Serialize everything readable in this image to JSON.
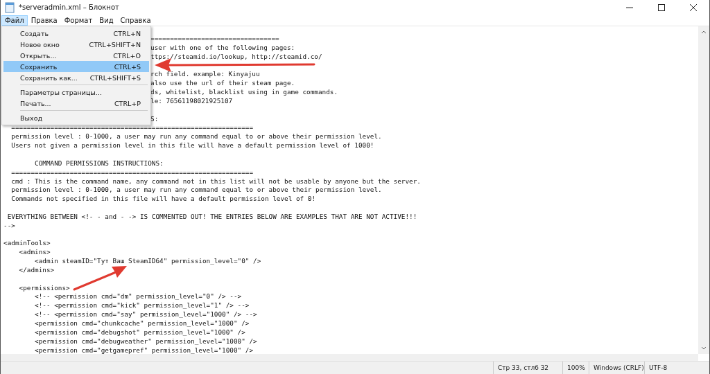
{
  "window": {
    "title": "*serveradmin.xml – Блокнот"
  },
  "menubar": [
    {
      "label": "Файл",
      "selected": true
    },
    {
      "label": "Правка",
      "selected": false
    },
    {
      "label": "Формат",
      "selected": false
    },
    {
      "label": "Вид",
      "selected": false
    },
    {
      "label": "Справка",
      "selected": false
    }
  ],
  "file_menu": [
    {
      "kind": "item",
      "label": "Создать",
      "shortcut": "CTRL+N",
      "selected": false
    },
    {
      "kind": "item",
      "label": "Новое окно",
      "shortcut": "CTRL+SHIFT+N",
      "selected": false
    },
    {
      "kind": "item",
      "label": "Открыть...",
      "shortcut": "CTRL+O",
      "selected": false
    },
    {
      "kind": "item",
      "label": "Сохранить",
      "shortcut": "CTRL+S",
      "selected": true
    },
    {
      "kind": "item",
      "label": "Сохранить как...",
      "shortcut": "CTRL+SHIFT+S",
      "selected": false
    },
    {
      "kind": "separator"
    },
    {
      "kind": "item",
      "label": "Параметры страницы...",
      "selected": false
    },
    {
      "kind": "item",
      "label": "Печать...",
      "shortcut": "CTRL+P",
      "selected": false
    },
    {
      "kind": "separator"
    },
    {
      "kind": "item",
      "label": "Выход",
      "selected": false
    }
  ],
  "editor": {
    "lines": [
      {
        "kind": "partial",
        "text": "================================="
      },
      {
        "kind": "partial",
        "text": "user with one of the following pages:"
      },
      {
        "kind": "partial",
        "text": "ttps://steamid.io/lookup, http://steamid.co/"
      },
      {
        "kind": "blank"
      },
      {
        "kind": "partial",
        "text": "rch field. example: Kinyajuu"
      },
      {
        "kind": "partial",
        "text": "also use the url of their steam page."
      },
      {
        "kind": "partial",
        "text": "ds, whitelist, blacklist using in game commands."
      },
      {
        "kind": "partial",
        "text": "le: 76561198021925107"
      },
      {
        "kind": "blank"
      },
      {
        "kind": "partial",
        "text": "S:"
      },
      {
        "kind": "full",
        "text": "  =============================================================="
      },
      {
        "kind": "full",
        "text": "  permission level : 0-1000, a user may run any command equal to or above their permission level."
      },
      {
        "kind": "full",
        "text": "  Users not given a permission level in this file will have a default permission level of 1000!"
      },
      {
        "kind": "blank"
      },
      {
        "kind": "full",
        "text": "        COMMAND PERMISSIONS INSTRUCTIONS:"
      },
      {
        "kind": "full",
        "text": "  =============================================================="
      },
      {
        "kind": "full",
        "text": "  cmd : This is the command name, any command not in this list will not be usable by anyone but the server."
      },
      {
        "kind": "full",
        "text": "  permission level : 0-1000, a user may run any command equal to or above their permission level."
      },
      {
        "kind": "full",
        "text": "  Commands not specified in this file will have a default permission level of 0!"
      },
      {
        "kind": "blank"
      },
      {
        "kind": "full",
        "text": " EVERYTHING BETWEEN <!- - and - -> IS COMMENTED OUT! THE ENTRIES BELOW ARE EXAMPLES THAT ARE NOT ACTIVE!!!"
      },
      {
        "kind": "full",
        "text": "-->"
      },
      {
        "kind": "blank"
      },
      {
        "kind": "full",
        "text": "<adminTools>"
      },
      {
        "kind": "full",
        "text": "    <admins>"
      },
      {
        "kind": "full",
        "text": "        <admin steamID=\"Тут Ваш SteamID64\" permission_level=\"0\" />"
      },
      {
        "kind": "full",
        "text": "    </admins>"
      },
      {
        "kind": "blank"
      },
      {
        "kind": "full",
        "text": "    <permissions>"
      },
      {
        "kind": "full",
        "text": "        <!-- <permission cmd=\"dm\" permission_level=\"0\" /> -->"
      },
      {
        "kind": "full",
        "text": "        <!-- <permission cmd=\"kick\" permission_level=\"1\" /> -->"
      },
      {
        "kind": "full",
        "text": "        <!-- <permission cmd=\"say\" permission_level=\"1000\" /> -->"
      },
      {
        "kind": "full",
        "text": "        <permission cmd=\"chunkcache\" permission_level=\"1000\" />"
      },
      {
        "kind": "full",
        "text": "        <permission cmd=\"debugshot\" permission_level=\"1000\" />"
      },
      {
        "kind": "full",
        "text": "        <permission cmd=\"debugweather\" permission_level=\"1000\" />"
      },
      {
        "kind": "full",
        "text": "        <permission cmd=\"getgamepref\" permission_level=\"1000\" />"
      }
    ]
  },
  "status_bar": {
    "position": "Стр 33, стлб 32",
    "zoom": "100%",
    "line_endings": "Windows (CRLF)",
    "encoding": "UTF-8"
  }
}
